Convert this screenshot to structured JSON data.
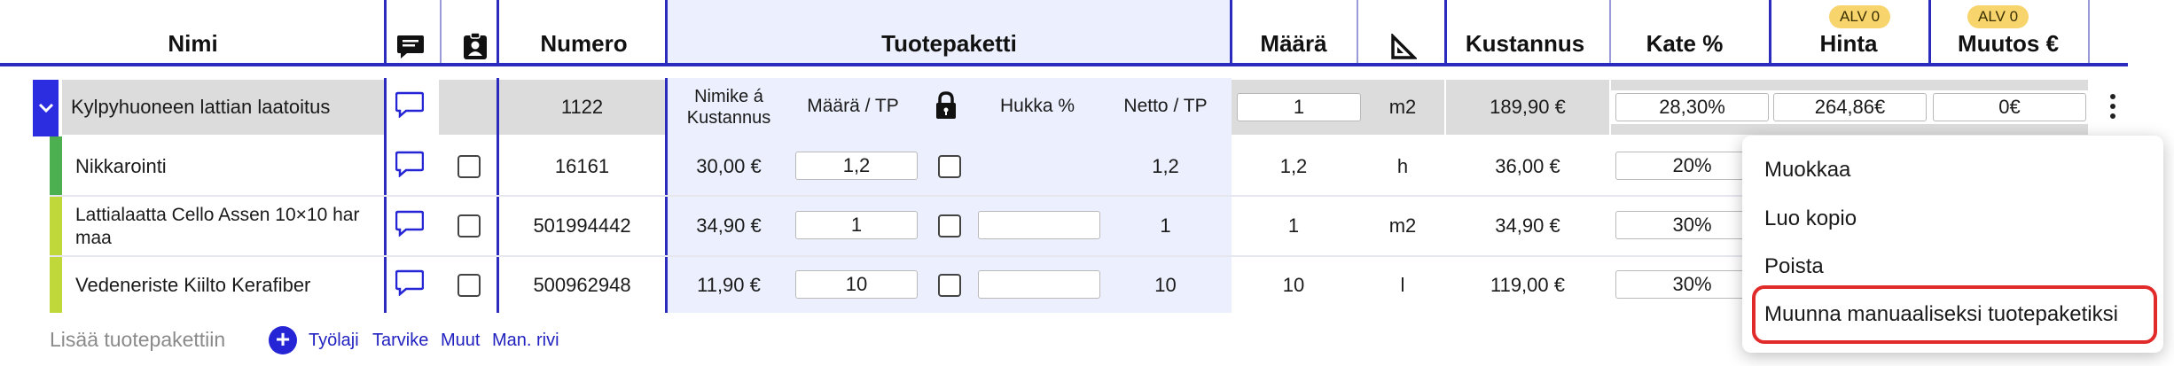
{
  "header": {
    "name": "Nimi",
    "number": "Numero",
    "product_package": "Tuotepaketti",
    "quantity": "Määrä",
    "cost": "Kustannus",
    "margin": "Kate %",
    "price": "Hinta",
    "change": "Muutos €",
    "alv_price": "ALV 0",
    "alv_change": "ALV 0"
  },
  "main_row": {
    "name": "Kylpyhuoneen lattian laatoitus",
    "number": "1122",
    "col_unit_cost_line1": "Nimike á",
    "col_unit_cost_line2": "Kustannus",
    "col_qty_per_tp": "Määrä / TP",
    "col_waste": "Hukka %",
    "col_net_per_tp": "Netto / TP",
    "quantity": "1",
    "unit": "m2",
    "cost": "189,90 €",
    "margin": "28,30%",
    "price": "264,86€",
    "change": "0€"
  },
  "sub_rows": [
    {
      "name": "Nikkarointi",
      "number": "16161",
      "unit_cost": "30,00 €",
      "qty_per_tp": "1,2",
      "waste": "",
      "net_per_tp": "1,2",
      "quantity": "1,2",
      "unit": "h",
      "cost": "36,00 €",
      "margin": "20%",
      "bar_color": "#4caf50"
    },
    {
      "name": "Lattialaatta Cello Assen 10×10 har maa",
      "name_line1": "Lattialaatta Cello Assen 10×10 har",
      "name_line2": "maa",
      "number": "501994442",
      "unit_cost": "34,90 €",
      "qty_per_tp": "1",
      "waste": "",
      "net_per_tp": "1",
      "quantity": "1",
      "unit": "m2",
      "cost": "34,90 €",
      "margin": "30%",
      "bar_color": "#c0d83a"
    },
    {
      "name": "Vedeneriste Kiilto Kerafiber",
      "number": "500962948",
      "unit_cost": "11,90 €",
      "qty_per_tp": "10",
      "waste": "",
      "net_per_tp": "10",
      "quantity": "10",
      "unit": "l",
      "cost": "119,00 €",
      "margin": "30%",
      "bar_color": "#c0d83a"
    }
  ],
  "footer": {
    "add_label": "Lisää tuotepakettiin",
    "links": [
      "Työlaji",
      "Tarvike",
      "Muut",
      "Man. rivi"
    ]
  },
  "context_menu": {
    "items": [
      "Muokkaa",
      "Luo kopio",
      "Poista",
      "Muunna manuaaliseksi tuotepaketiksi"
    ],
    "highlight_color": "#e12a2a"
  },
  "colors": {
    "accent": "#2b2bbd",
    "tp_background": "#eceffd",
    "main_row_grey": "#dcdcdc",
    "alv_badge": "#f7d46c"
  },
  "icons": [
    "comment-icon",
    "clipboard-user-icon",
    "lock-icon",
    "set-square-icon",
    "chevron-down-icon",
    "kebab-icon",
    "plus-icon"
  ]
}
